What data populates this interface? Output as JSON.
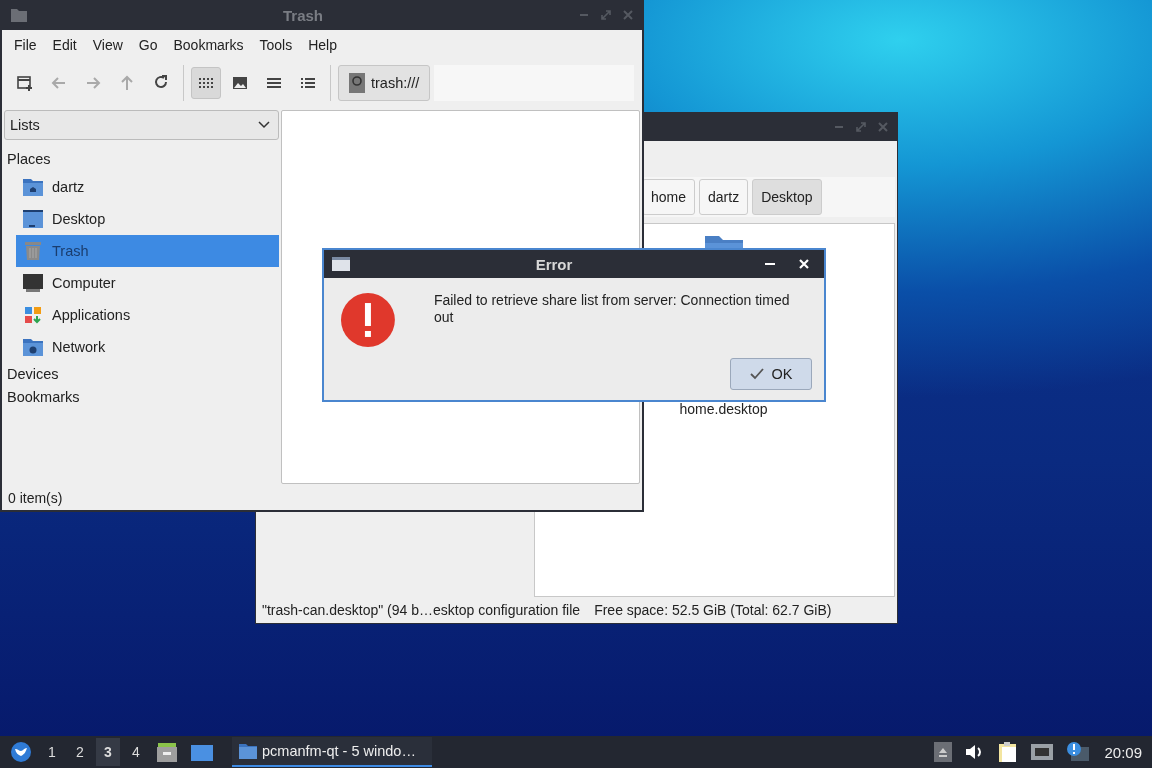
{
  "front_window": {
    "title": "Trash",
    "menu": [
      "File",
      "Edit",
      "View",
      "Go",
      "Bookmarks",
      "Tools",
      "Help"
    ],
    "nav_buttons": [
      {
        "kind": "new-tab",
        "disabled": false
      },
      {
        "kind": "back",
        "disabled": true
      },
      {
        "kind": "forward",
        "disabled": true
      },
      {
        "kind": "up",
        "disabled": true
      },
      {
        "kind": "reload",
        "disabled": false
      }
    ],
    "view_modes": [
      {
        "kind": "icons",
        "selected": true
      },
      {
        "kind": "thumbnails",
        "selected": false
      },
      {
        "kind": "compact",
        "selected": false
      },
      {
        "kind": "detailed",
        "selected": false
      }
    ],
    "location": "trash:///",
    "side_pane": {
      "mode": "Lists",
      "sections": [
        {
          "label": "Places",
          "items": [
            {
              "label": "dartz",
              "kind": "home",
              "selected": false
            },
            {
              "label": "Desktop",
              "kind": "desktop",
              "selected": false
            },
            {
              "label": "Trash",
              "kind": "trash",
              "selected": true
            },
            {
              "label": "Computer",
              "kind": "computer",
              "selected": false
            },
            {
              "label": "Applications",
              "kind": "applications",
              "selected": false
            },
            {
              "label": "Network",
              "kind": "network",
              "selected": false
            }
          ]
        },
        {
          "label": "Devices"
        },
        {
          "label": "Bookmarks"
        }
      ]
    },
    "status": "0 item(s)"
  },
  "back_window": {
    "path": [
      {
        "label": "home",
        "selected": false
      },
      {
        "label": "dartz",
        "selected": false
      },
      {
        "label": "Desktop",
        "selected": true
      }
    ],
    "files": [
      {
        "name": "home.desktop"
      }
    ],
    "status": [
      "\"trash-can.desktop\" (94 b…esktop configuration file",
      "Free space: 52.5 GiB (Total: 62.7 GiB)"
    ]
  },
  "dialog": {
    "title": "Error",
    "message": "Failed to retrieve share list from server: Connection timed out",
    "button": "OK"
  },
  "taskbar": {
    "workspaces": [
      {
        "label": "1",
        "selected": false
      },
      {
        "label": "2",
        "selected": false
      },
      {
        "label": "3",
        "selected": true
      },
      {
        "label": "4",
        "selected": false
      }
    ],
    "task": "pcmanfm-qt - 5 windo…",
    "clock": "20:09"
  }
}
